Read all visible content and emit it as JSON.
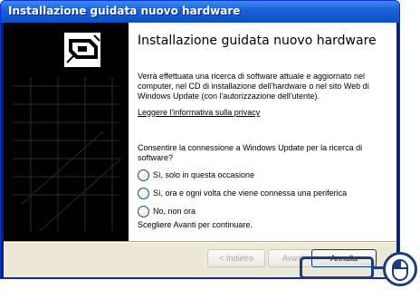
{
  "window": {
    "title": "Installazione guidata nuovo hardware"
  },
  "wizard": {
    "heading": "Installazione guidata nuovo hardware",
    "intro": "Verrà effettuata una ricerca di software attuale e aggiornato nel computer, nel CD di installazione dell'hardware o nel sito Web di Windows Update (con l'autorizzazione dell'utente).",
    "privacy_link": "Leggere l'informativa sulla privacy",
    "question": "Consentire la connessione a Windows Update per la ricerca di software?",
    "options": [
      {
        "label": "Sì, solo in questa occasione"
      },
      {
        "label": "Sì, ora e ogni volta che viene connessa una periferica"
      },
      {
        "label": "No, non ora"
      }
    ],
    "footer": "Scegliere Avanti per continuare."
  },
  "buttons": {
    "back": "< Indietro",
    "next": "Avanti >",
    "cancel": "Annulla"
  },
  "colors": {
    "titlebar": "#0a50c8",
    "dialog_bg": "#ece9d8",
    "highlight": "#1a3d7c"
  },
  "icons": {
    "wizard_graphic": "hardware-card-icon",
    "callout": "mouse-icon"
  }
}
